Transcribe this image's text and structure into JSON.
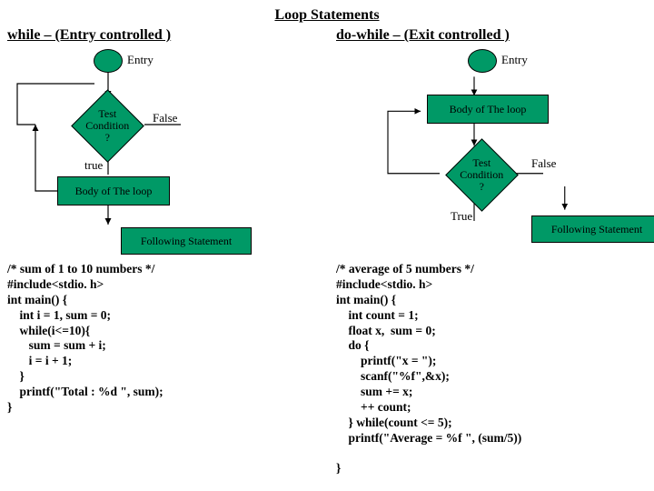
{
  "title": "Loop Statements",
  "while": {
    "subtitle": "while –  (Entry controlled )",
    "entry": "Entry",
    "condition": "Test\nCondition\n?",
    "false": "False",
    "true": "true",
    "body": "Body of The loop",
    "following": "Following Statement",
    "code": "/* sum of 1 to 10 numbers */\n#include<stdio. h>\nint main() {\n    int i = 1, sum = 0;\n    while(i<=10){\n       sum = sum + i;\n       i = i + 1;\n    }\n    printf(\"Total : %d \", sum);\n}"
  },
  "dowhile": {
    "subtitle": "do-while – (Exit controlled )",
    "entry": "Entry",
    "body": "Body of The loop",
    "condition": "Test\nCondition\n?",
    "false": "False",
    "true": "True",
    "following": "Following Statement",
    "code": "/* average of 5 numbers */\n#include<stdio. h>\nint main() {\n    int count = 1;\n    float x,  sum = 0;\n    do {\n        printf(\"x = \");\n        scanf(\"%f\",&x);\n        sum += x;\n        ++ count;\n    } while(count <= 5);\n    printf(\"Average = %f \", (sum/5))\n\n}"
  }
}
